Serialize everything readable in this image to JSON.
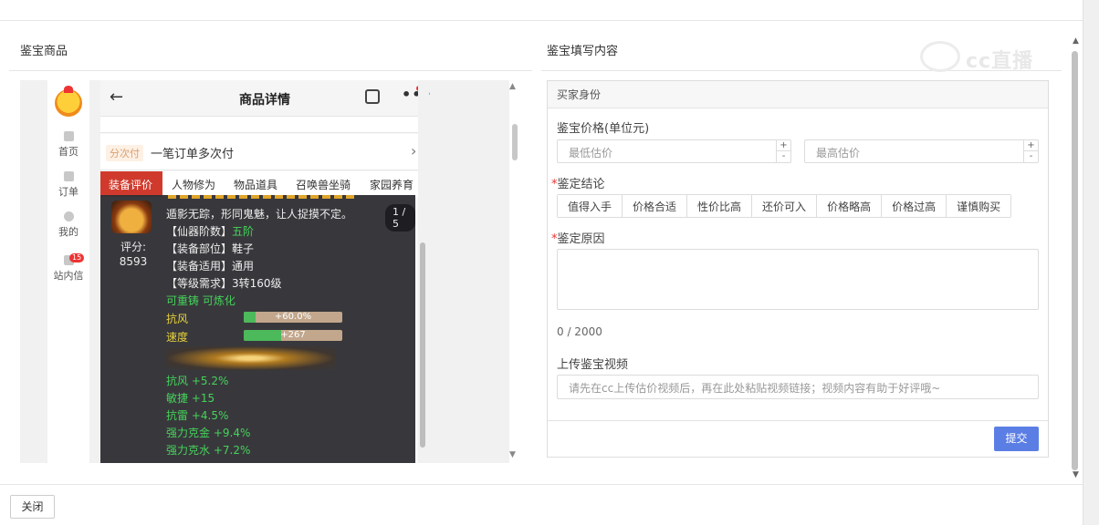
{
  "left_panel": {
    "title": "鉴宝商品"
  },
  "right_panel": {
    "title": "鉴宝填写内容"
  },
  "watermark": "cc直播",
  "phone": {
    "sidebar": [
      {
        "label": "首页",
        "icon": "home-icon"
      },
      {
        "label": "订单",
        "icon": "order-icon"
      },
      {
        "label": "我的",
        "icon": "user-icon"
      },
      {
        "label": "站内信",
        "icon": "mail-icon",
        "badge": "15"
      }
    ],
    "header": {
      "title": "商品详情"
    },
    "split_pay": {
      "tag": "分次付",
      "text": "一笔订单多次付"
    },
    "tabs": [
      "装备评价",
      "人物修为",
      "物品道具",
      "召唤兽坐骑",
      "家园养育"
    ],
    "item": {
      "page": "1 / 5",
      "score_label": "评分:",
      "score_value": "8593",
      "desc": "遁影无踪，形同鬼魅，让人捉摸不定。",
      "attrs": [
        {
          "key": "【仙器阶数】",
          "value": "五阶"
        },
        {
          "key": "【装备部位】",
          "value": "鞋子"
        },
        {
          "key": "【装备适用】",
          "value": "通用"
        },
        {
          "key": "【等级需求】",
          "value": "3转160级"
        }
      ],
      "refine": "可重铸 可炼化",
      "bars": [
        {
          "label": "抗风",
          "value": "+60.0%",
          "fill": 0.12
        },
        {
          "label": "速度",
          "value": "+267",
          "fill": 0.38
        }
      ],
      "stats": [
        "抗风 +5.2%",
        "敏捷 +15",
        "抗雷 +4.5%",
        "强力克金 +9.4%",
        "强力克水 +7.2%"
      ]
    }
  },
  "form": {
    "section": "买家身份",
    "price_label": "鉴宝价格(单位元)",
    "min_placeholder": "最低估价",
    "max_placeholder": "最高估价",
    "conclusion_label": "鉴定结论",
    "conclusion_options": [
      "值得入手",
      "价格合适",
      "性价比高",
      "还价可入",
      "价格略高",
      "价格过高",
      "谨慎购买"
    ],
    "reason_label": "鉴定原因",
    "counter": "0 / 2000",
    "video_label": "上传鉴宝视频",
    "video_placeholder": "请先在cc上传估价视频后，再在此处粘贴视频链接；视频内容有助于好评哦~",
    "submit": "提交"
  },
  "footer": {
    "close": "关闭"
  },
  "colors": {
    "accent": "#5b7ee5",
    "tab_active": "#d03a2c",
    "green": "#45d35a"
  }
}
